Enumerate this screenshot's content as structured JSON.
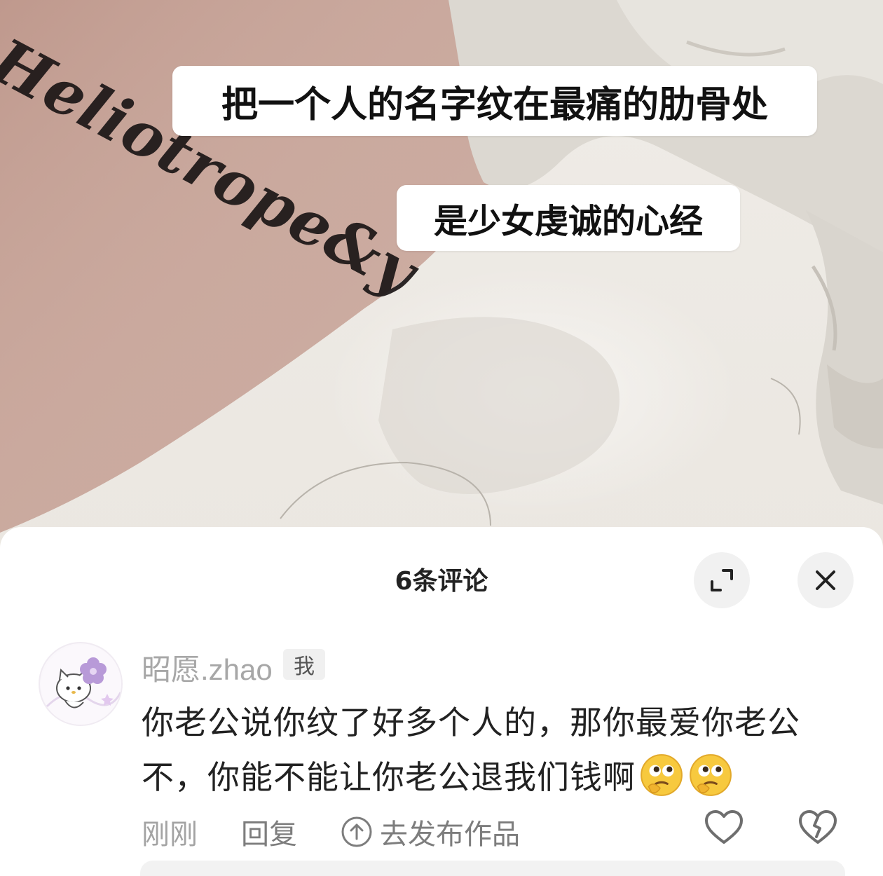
{
  "post": {
    "tattoo_text": "Heliotrope&y",
    "captions": [
      "把一个人的名字纹在最痛的肋骨处",
      "是少女虔诚的心经"
    ]
  },
  "comments_panel": {
    "title": "6条评论",
    "expand_icon": "expand-icon",
    "close_icon": "close-icon"
  },
  "comment": {
    "username": "昭愿.zhao",
    "badge": "我",
    "text": "你老公说你纹了好多个人的，那你最爱你老公不，你能不能让你老公退我们钱啊",
    "emojis": [
      "thinking-face-emoji",
      "thinking-face-emoji"
    ],
    "time": "刚刚",
    "reply_label": "回复",
    "publish_label": "去发布作品",
    "like_icon": "heart-outline-icon",
    "dislike_icon": "broken-heart-icon"
  }
}
